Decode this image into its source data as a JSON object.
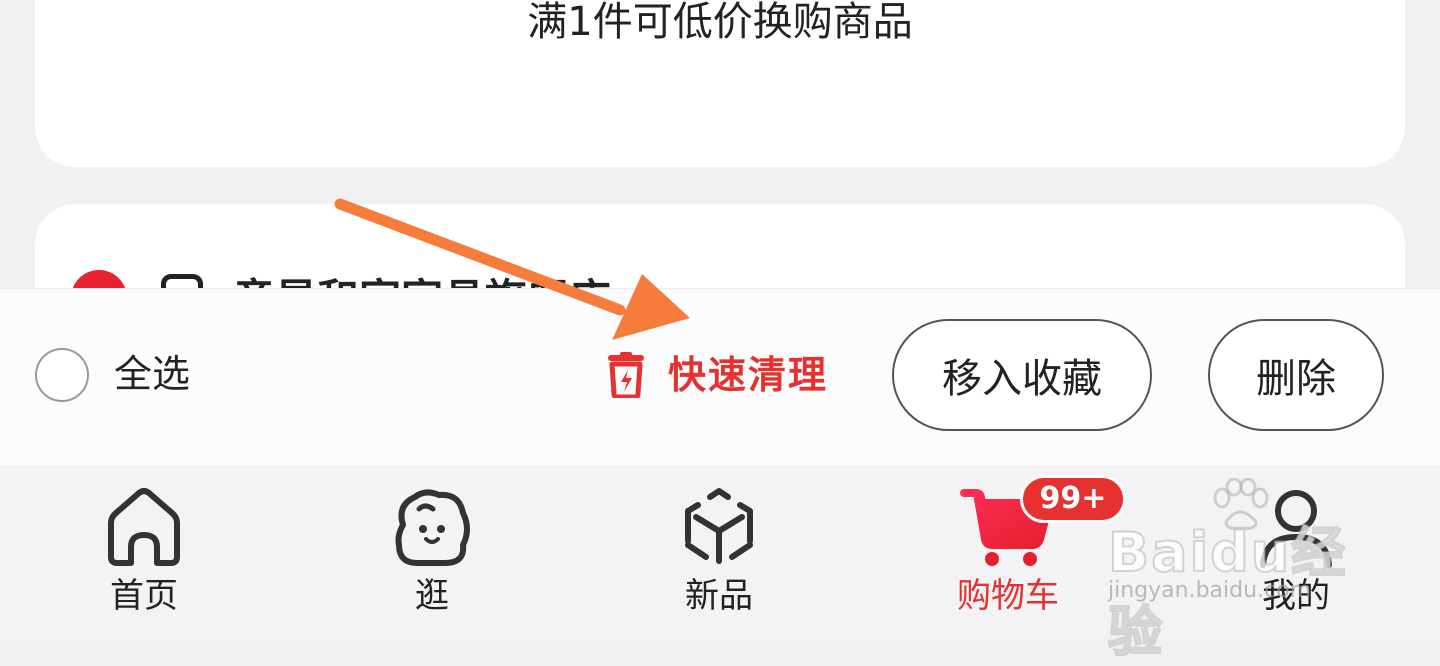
{
  "promo": {
    "text": "满1件可低价换购商品"
  },
  "store": {
    "name": "章星和家家具旗舰店"
  },
  "action_bar": {
    "select_all_label": "全选",
    "quick_clean_label": "快速清理",
    "move_to_favorites_label": "移入收藏",
    "delete_label": "删除"
  },
  "tabbar": {
    "tabs": [
      {
        "label": "首页",
        "icon": "home-icon"
      },
      {
        "label": "逛",
        "icon": "face-icon"
      },
      {
        "label": "新品",
        "icon": "cube-icon"
      },
      {
        "label": "购物车",
        "icon": "cart-icon",
        "active": true
      },
      {
        "label": "我的",
        "icon": "user-icon"
      }
    ],
    "cart_badge": "99+"
  },
  "watermark": {
    "brand": "Baidu经验",
    "site": "jingyan.baidu.com"
  },
  "colors": {
    "accent": "#e5312f",
    "arrow": "#f57c3a",
    "background": "#f1f0f2"
  }
}
